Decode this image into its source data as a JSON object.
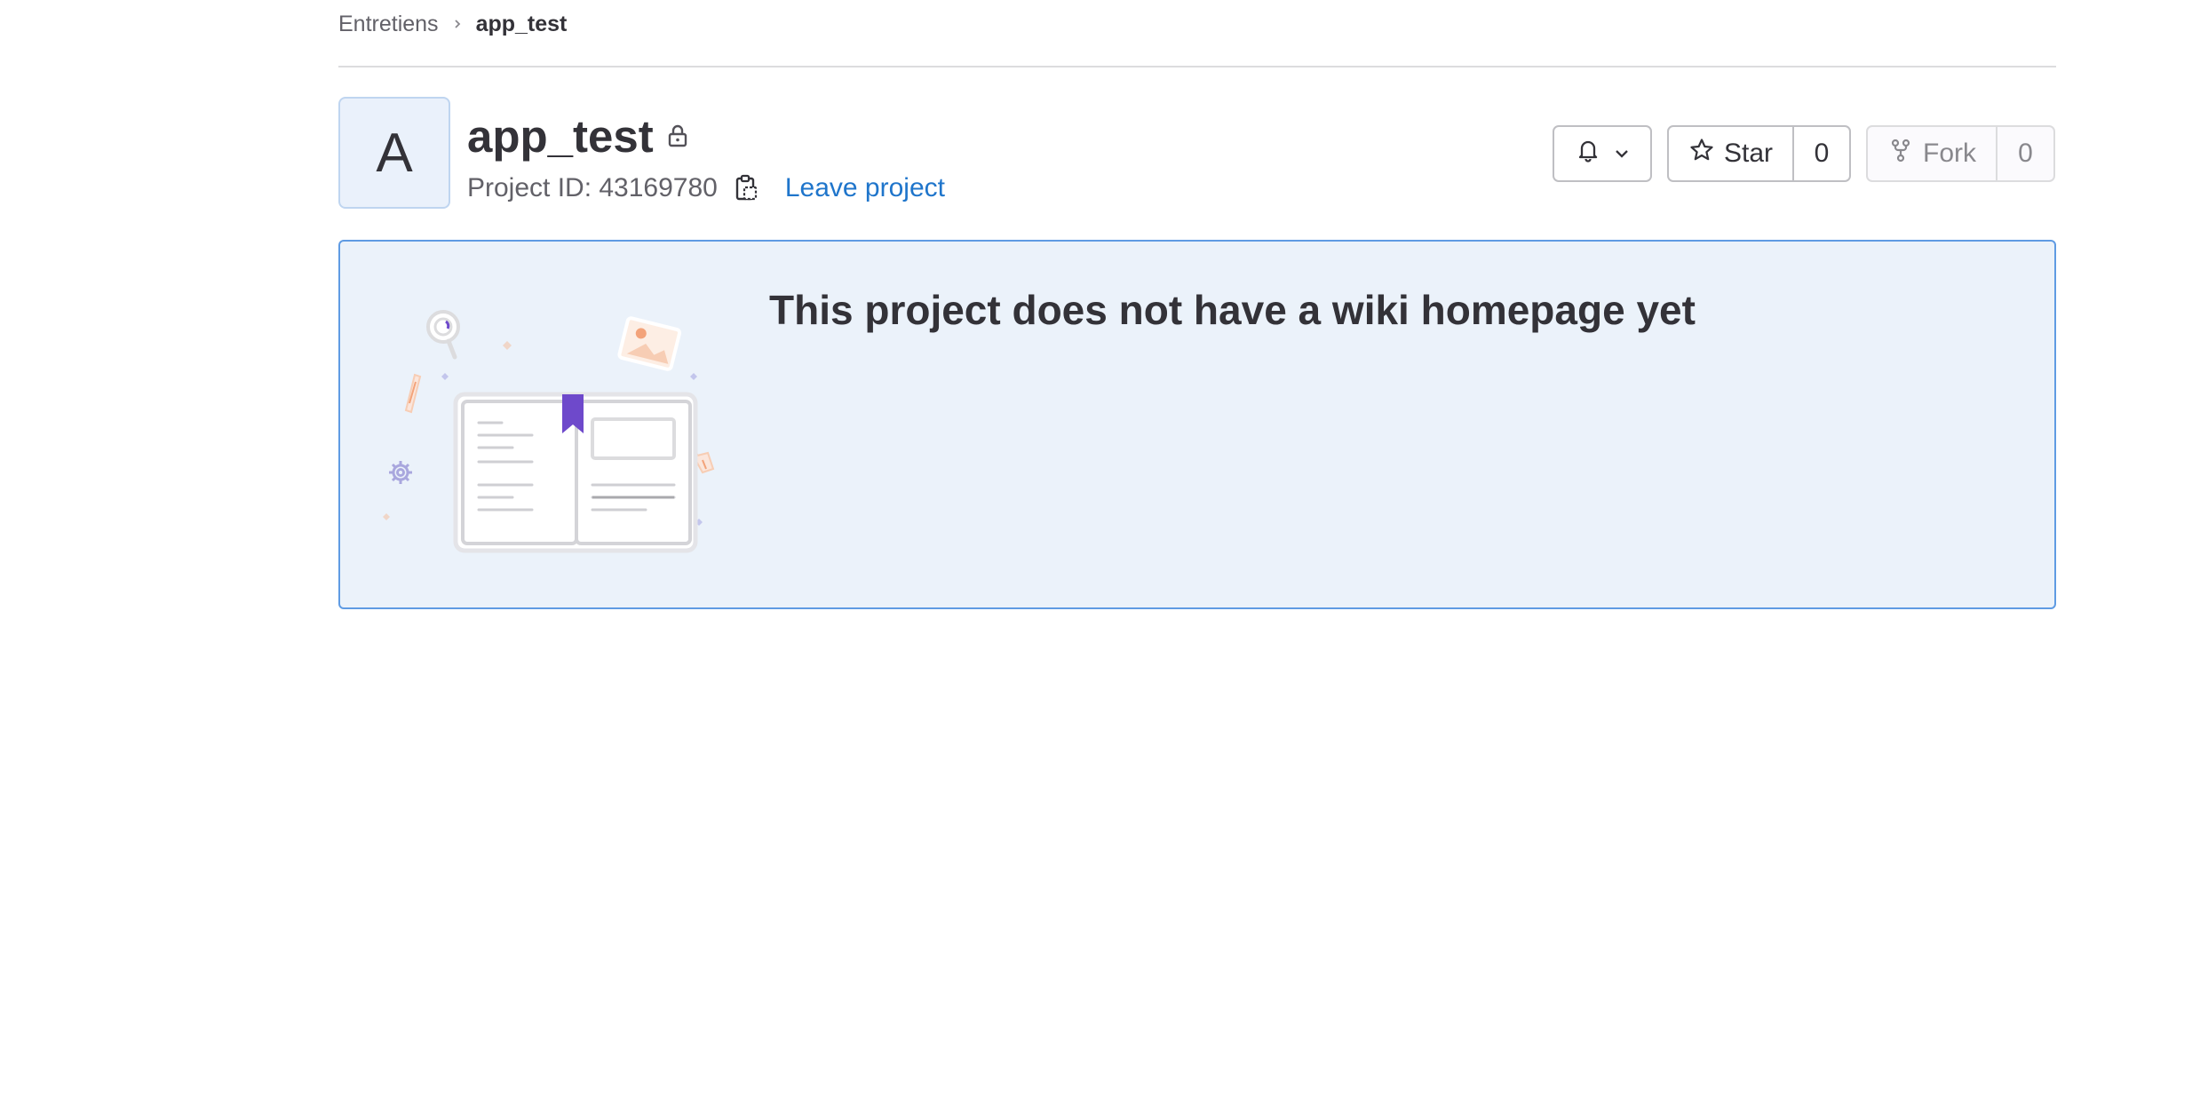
{
  "breadcrumb": {
    "parent": "Entretiens",
    "current": "app_test"
  },
  "project": {
    "avatar_letter": "A",
    "title": "app_test",
    "id_label": "Project ID: 43169780",
    "leave_label": "Leave project"
  },
  "actions": {
    "star_label": "Star",
    "star_count": "0",
    "fork_label": "Fork",
    "fork_count": "0"
  },
  "wiki": {
    "empty_heading": "This project does not have a wiki homepage yet"
  },
  "icons": [
    "chevron-right-icon",
    "lock-icon",
    "copy-clipboard-icon",
    "bell-icon",
    "chevron-down-icon",
    "star-icon",
    "fork-icon"
  ],
  "colors": {
    "link": "#1f75cb",
    "box_border": "#5f9be3",
    "box_bg": "#ebf2fa",
    "bookmark": "#6e49cb"
  }
}
